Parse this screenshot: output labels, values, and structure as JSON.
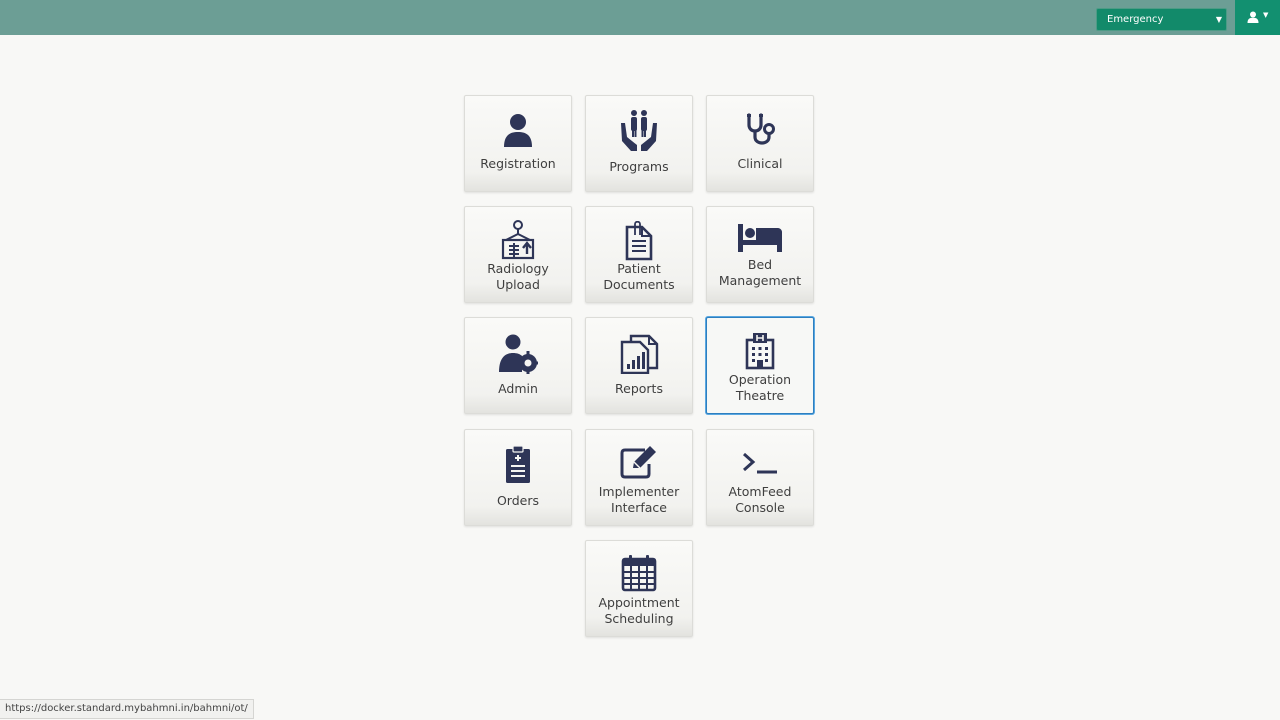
{
  "header": {
    "location": "Emergency",
    "user_icon": "user-icon"
  },
  "apps": [
    {
      "label": "Registration",
      "icon": "user-icon"
    },
    {
      "label": "Programs",
      "icon": "family-hands-icon"
    },
    {
      "label": "Clinical",
      "icon": "stethoscope-icon"
    },
    {
      "label": "Radiology Upload",
      "icon": "radiology-icon"
    },
    {
      "label": "Patient Documents",
      "icon": "clipped-document-icon"
    },
    {
      "label": "Bed Management",
      "icon": "bed-icon"
    },
    {
      "label": "Admin",
      "icon": "user-gear-icon"
    },
    {
      "label": "Reports",
      "icon": "reports-chart-icon"
    },
    {
      "label": "Operation Theatre",
      "icon": "hospital-building-icon"
    },
    {
      "label": "Orders",
      "icon": "clipboard-list-icon"
    },
    {
      "label": "Implementer Interface",
      "icon": "edit-icon"
    },
    {
      "label": "AtomFeed Console",
      "icon": "terminal-icon"
    },
    {
      "label": "Appointment Scheduling",
      "icon": "calendar-icon"
    }
  ],
  "labels": {
    "registration": "Registration",
    "programs": "Programs",
    "clinical": "Clinical",
    "radiology_1": "Radiology",
    "radiology_2": "Upload",
    "patient_docs_1": "Patient",
    "patient_docs_2": "Documents",
    "bed_1": "Bed",
    "bed_2": "Management",
    "admin": "Admin",
    "reports": "Reports",
    "ot_1": "Operation",
    "ot_2": "Theatre",
    "orders": "Orders",
    "impl_1": "Implementer",
    "impl_2": "Interface",
    "atom_1": "AtomFeed",
    "atom_2": "Console",
    "appt_1": "Appointment",
    "appt_2": "Scheduling"
  },
  "status_bar": {
    "url": "https://docker.standard.mybahmni.in/bahmni/ot/"
  },
  "colors": {
    "header": "#6c9e95",
    "select": "#128a6a",
    "icon": "#2e3557",
    "active_border": "#2d7fc0"
  }
}
